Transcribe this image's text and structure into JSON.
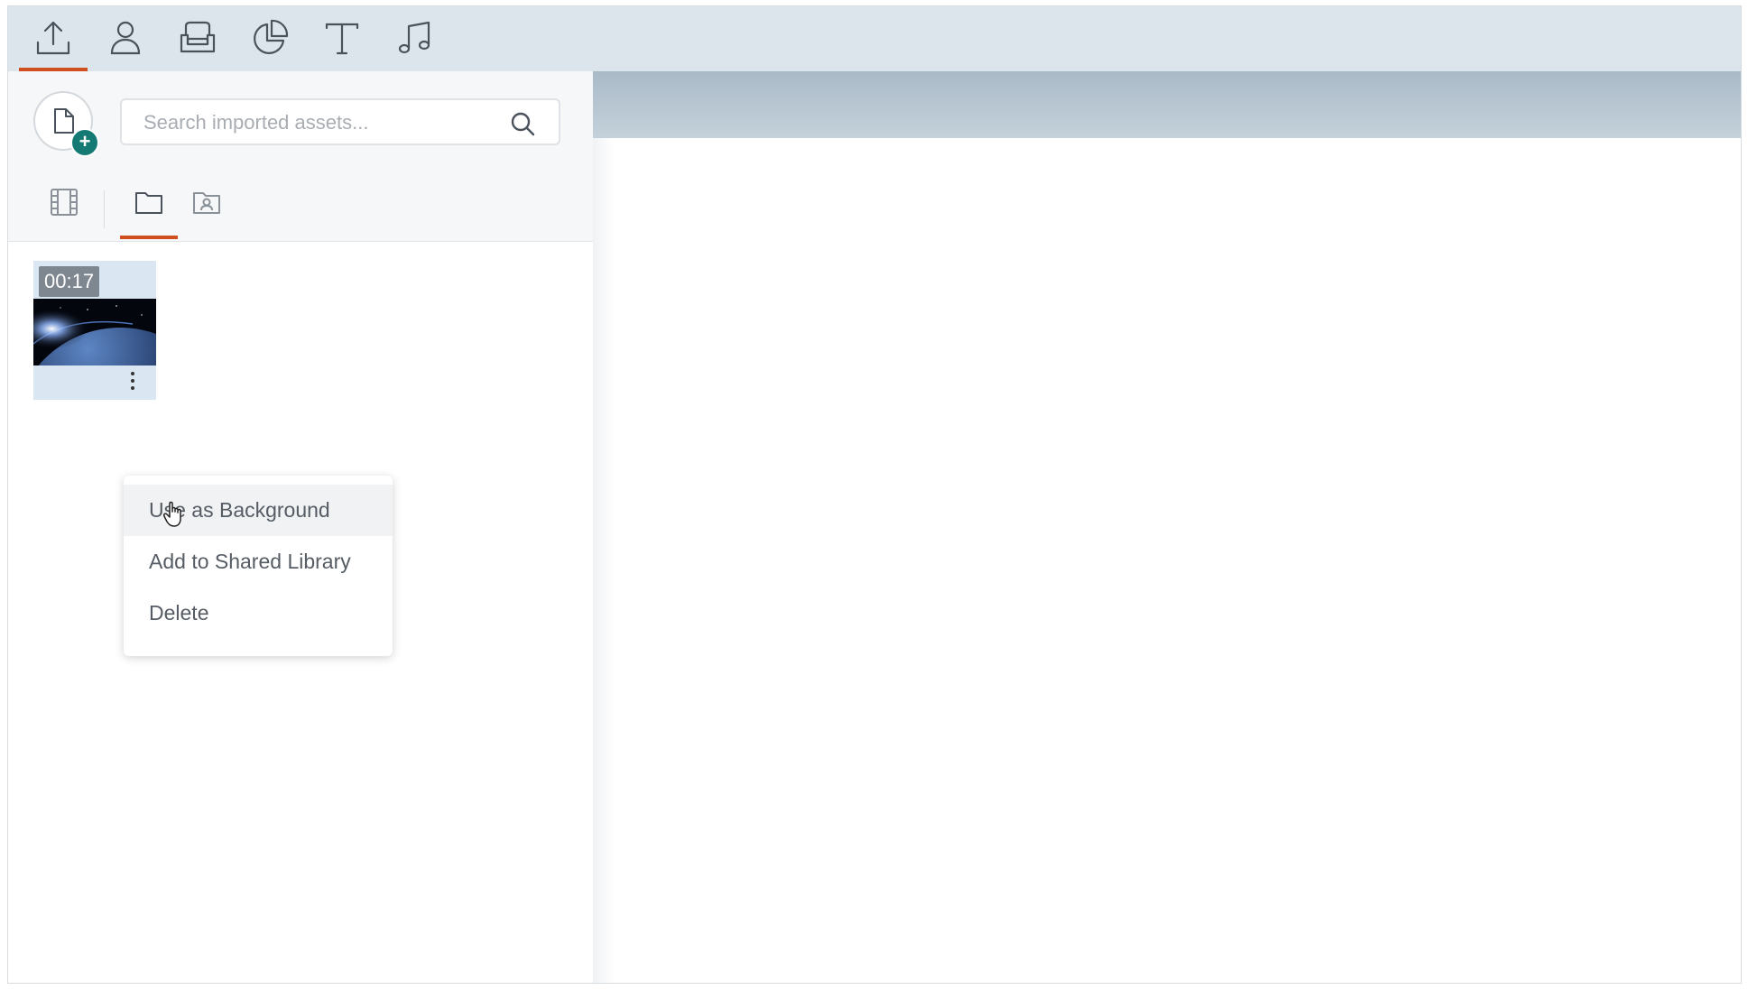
{
  "topbar": {
    "tabs": [
      {
        "icon": "upload-icon",
        "active": true
      },
      {
        "icon": "character-icon",
        "active": false
      },
      {
        "icon": "props-icon",
        "active": false
      },
      {
        "icon": "chart-icon",
        "active": false
      },
      {
        "icon": "text-icon",
        "active": false
      },
      {
        "icon": "music-icon",
        "active": false
      }
    ]
  },
  "sidebar": {
    "new_asset_icon": "file-add-icon",
    "search": {
      "placeholder": "Search imported assets..."
    },
    "subtabs": [
      {
        "icon": "film-icon",
        "active": false
      },
      {
        "icon": "folder-icon",
        "active": true
      },
      {
        "icon": "shared-folder-icon",
        "active": false
      }
    ],
    "asset": {
      "duration": "00:17",
      "thumbnail": "space-earth-video-thumbnail"
    },
    "context_menu": {
      "items": [
        {
          "label": "Use as Background",
          "hover": true
        },
        {
          "label": "Add to Shared Library",
          "hover": false
        },
        {
          "label": "Delete",
          "hover": false
        }
      ]
    }
  },
  "colors": {
    "accent": "#cf4e1d",
    "topbar_bg": "#dde5ec",
    "plus_badge": "#147a73",
    "thumb_bg": "#dbe6f3"
  }
}
